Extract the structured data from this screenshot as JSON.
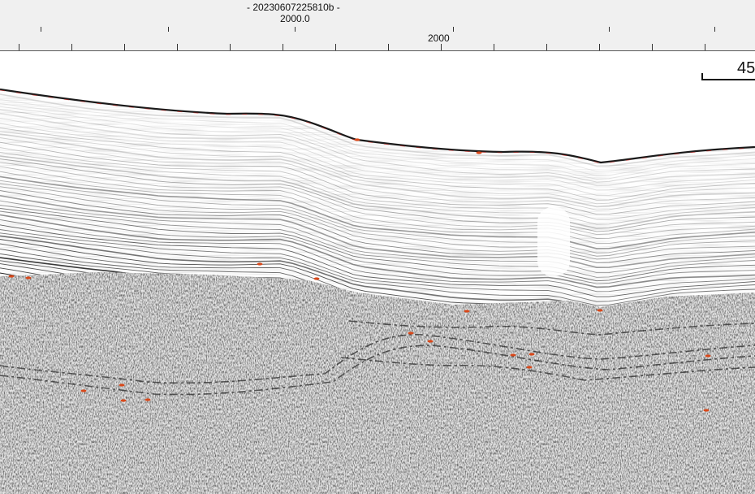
{
  "ruler": {
    "file_label": "- 20230607225810b -",
    "trace_label": "2000.0",
    "distance_label": "2000"
  },
  "scale_bar": {
    "value": "45"
  },
  "colors": {
    "background": "#ffffff",
    "ruler_background": "#f0f0f0",
    "reflector_dark": "#1a1a1a",
    "high_amplitude": "#d8481a",
    "seafloor_highlight": "#c0201a"
  }
}
